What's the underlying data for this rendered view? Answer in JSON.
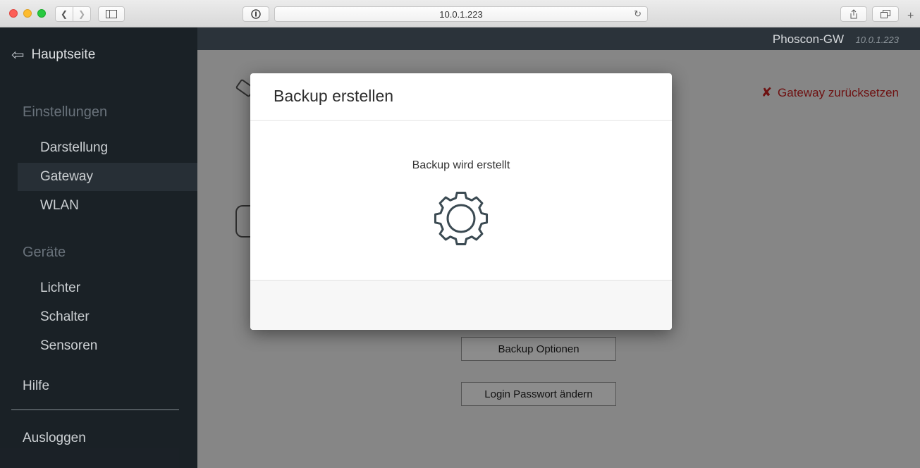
{
  "browser": {
    "url": "10.0.1.223"
  },
  "sidebar": {
    "home_label": "Hauptseite",
    "sections": [
      {
        "title": "Einstellungen",
        "items": [
          {
            "label": "Darstellung",
            "active": false
          },
          {
            "label": "Gateway",
            "active": true
          },
          {
            "label": "WLAN",
            "active": false
          }
        ]
      },
      {
        "title": "Geräte",
        "items": [
          {
            "label": "Lichter",
            "active": false
          },
          {
            "label": "Schalter",
            "active": false
          },
          {
            "label": "Sensoren",
            "active": false
          }
        ]
      }
    ],
    "help_label": "Hilfe",
    "logout_label": "Ausloggen"
  },
  "header": {
    "brand": "Phoscon-GW",
    "ip": "10.0.1.223"
  },
  "main": {
    "reset_label": "Gateway zurücksetzen",
    "reset_color": "#c92121",
    "backup_options_label": "Backup Optionen",
    "change_password_label": "Login Passwort ändern"
  },
  "modal": {
    "title": "Backup erstellen",
    "message": "Backup wird erstellt",
    "icon": "gear-icon"
  }
}
